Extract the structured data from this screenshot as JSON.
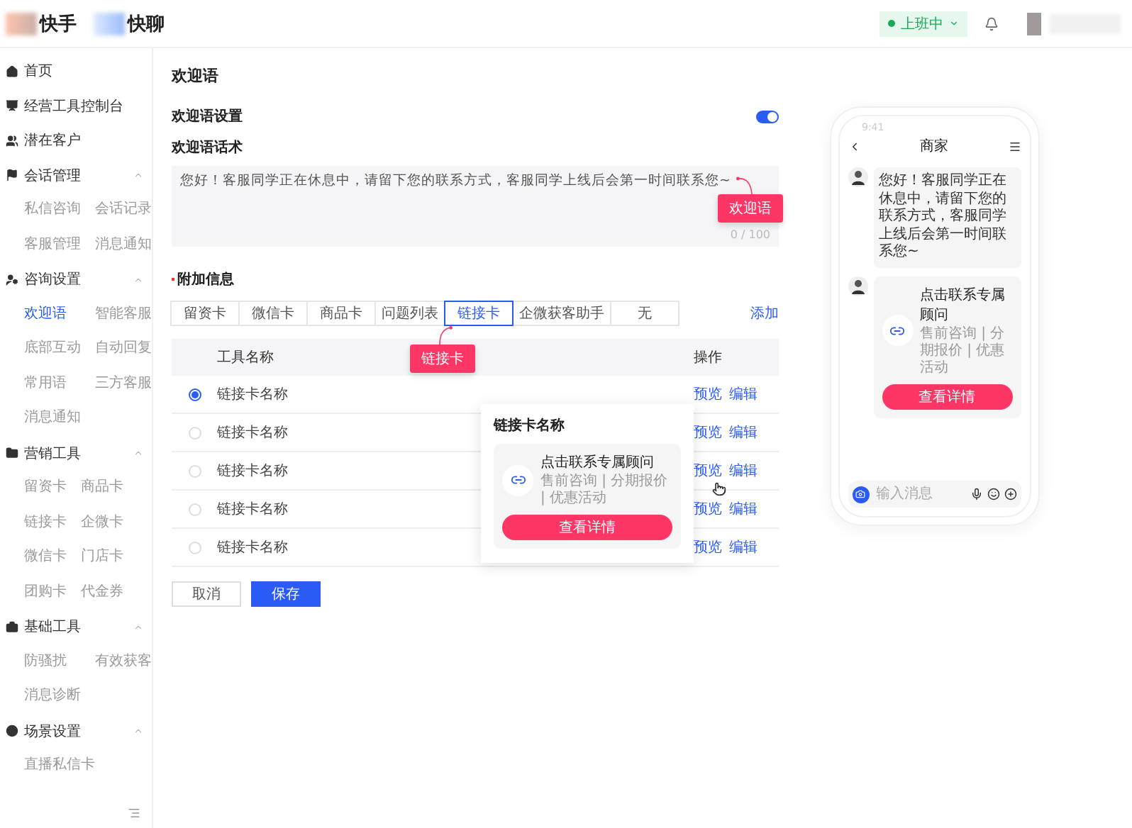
{
  "header": {
    "logos": [
      {
        "label": "快手"
      },
      {
        "label": "快聊"
      }
    ],
    "status": {
      "label": "上班中",
      "online": true
    }
  },
  "sidebar": {
    "groups": [
      {
        "label": "首页"
      },
      {
        "label": "经营工具控制台"
      },
      {
        "label": "潜在客户"
      },
      {
        "label": "会话管理",
        "expanded": true,
        "children": [
          {
            "label": "私信咨询",
            "selected": false
          },
          {
            "label": "会话记录",
            "selected": false
          },
          {
            "label": "客服管理",
            "selected": false
          },
          {
            "label": "消息通知",
            "selected": false
          }
        ]
      },
      {
        "label": "咨询设置",
        "expanded": true,
        "children": [
          {
            "label": "欢迎语",
            "selected": true
          },
          {
            "label": "智能客服",
            "selected": false
          },
          {
            "label": "底部互动",
            "selected": false
          },
          {
            "label": "自动回复",
            "selected": false
          },
          {
            "label": "常用语",
            "selected": false
          },
          {
            "label": "三方客服",
            "selected": false
          },
          {
            "label": "消息通知",
            "selected": false
          }
        ]
      },
      {
        "label": "营销工具",
        "expanded": true,
        "children": [
          {
            "label": "留资卡",
            "selected": false
          },
          {
            "label": "商品卡",
            "selected": false
          },
          {
            "label": "链接卡",
            "selected": false
          },
          {
            "label": "企微卡",
            "selected": false
          },
          {
            "label": "微信卡",
            "selected": false
          },
          {
            "label": "门店卡",
            "selected": false
          },
          {
            "label": "团购卡",
            "selected": false
          },
          {
            "label": "代金券",
            "selected": false
          }
        ]
      },
      {
        "label": "基础工具",
        "expanded": true,
        "children": [
          {
            "label": "防骚扰",
            "selected": false
          },
          {
            "label": "有效获客",
            "selected": false
          },
          {
            "label": "消息诊断",
            "selected": false
          }
        ]
      },
      {
        "label": "场景设置",
        "expanded": true,
        "children": [
          {
            "label": "直播私信卡",
            "selected": false
          }
        ]
      }
    ]
  },
  "page": {
    "title": "欢迎语"
  },
  "welcome": {
    "label": "欢迎语设置",
    "on": true,
    "script_label": "欢迎语话术",
    "value": "您好！客服同学正在休息中，请留下您的联系方式，客服同学上线后会第一时间联系您~",
    "counter": "0 / 100",
    "callout": "欢迎语"
  },
  "extra": {
    "label": "附加信息",
    "required": true,
    "add": "添加",
    "callout": "链接卡",
    "tabs": [
      {
        "label": "留资卡",
        "selected": false
      },
      {
        "label": "微信卡",
        "selected": false
      },
      {
        "label": "商品卡",
        "selected": false
      },
      {
        "label": "问题列表",
        "selected": false
      },
      {
        "label": "链接卡",
        "selected": true
      },
      {
        "label": "企微获客助手",
        "selected": false
      },
      {
        "label": "无",
        "selected": false
      }
    ]
  },
  "table": {
    "columns": [
      "工具名称",
      "操作"
    ],
    "rows": [
      {
        "name": "链接卡名称",
        "selected": true,
        "actions": [
          "预览",
          "编辑"
        ]
      },
      {
        "name": "链接卡名称",
        "selected": false,
        "actions": [
          "预览",
          "编辑"
        ]
      },
      {
        "name": "链接卡名称",
        "selected": false,
        "actions": [
          "预览",
          "编辑"
        ]
      },
      {
        "name": "链接卡名称",
        "selected": false,
        "actions": [
          "预览",
          "编辑"
        ]
      },
      {
        "name": "链接卡名称",
        "selected": false,
        "actions": [
          "预览",
          "编辑"
        ]
      }
    ]
  },
  "popover": {
    "title": "链接卡名称",
    "card_title": "点击联系专属顾问",
    "card_subtitle": "售前咨询 | 分期报价 | 优惠活动",
    "button": "查看详情"
  },
  "buttons": [
    {
      "label": "取消",
      "kind": "secondary"
    },
    {
      "label": "保存",
      "kind": "primary"
    }
  ],
  "phone": {
    "time": "9:41",
    "title": "商家",
    "messages": [
      {
        "kind": "text",
        "text": "您好！客服同学正在休息中，请留下您的联系方式，客服同学上线后会第一时间联系您~"
      },
      {
        "kind": "card",
        "title": "点击联系专属顾问",
        "subtitle": "售前咨询 | 分期报价 | 优惠活动",
        "button": "查看详情"
      }
    ],
    "placeholder": "输入消息"
  }
}
